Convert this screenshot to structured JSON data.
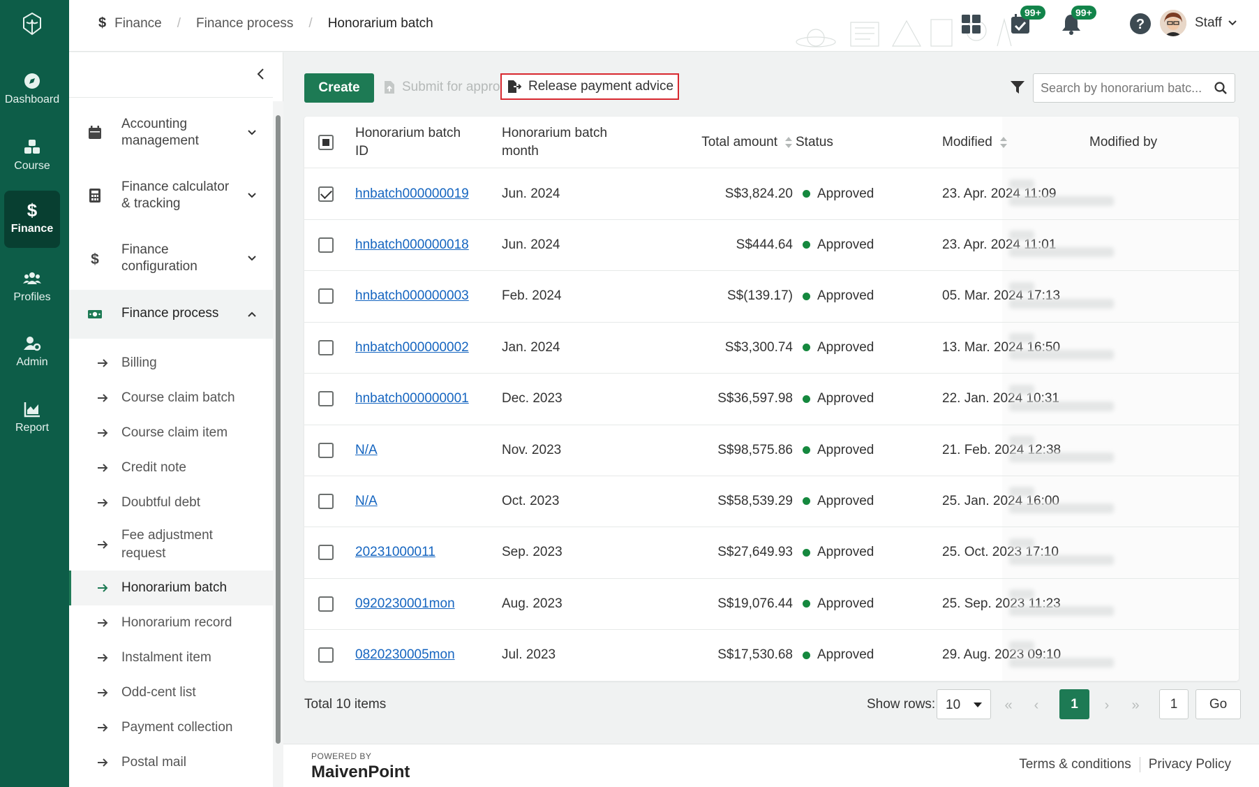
{
  "nav_rail": {
    "items": [
      {
        "label": "Dashboard"
      },
      {
        "label": "Course"
      },
      {
        "label": "Finance"
      },
      {
        "label": "Profiles"
      },
      {
        "label": "Admin"
      },
      {
        "label": "Report"
      }
    ]
  },
  "header": {
    "breadcrumb": [
      "Finance",
      "Finance process",
      "Honorarium batch"
    ],
    "tasks_badge": "99+",
    "notifications_badge": "99+",
    "user_name": "Staff"
  },
  "sidebar": {
    "groups": [
      {
        "label": "Accounting management"
      },
      {
        "label": "Finance calculator & tracking"
      },
      {
        "label": "Finance configuration"
      },
      {
        "label": "Finance process"
      }
    ],
    "subitems": [
      {
        "label": "Billing"
      },
      {
        "label": "Course claim batch"
      },
      {
        "label": "Course claim item"
      },
      {
        "label": "Credit note"
      },
      {
        "label": "Doubtful debt"
      },
      {
        "label": "Fee adjustment request"
      },
      {
        "label": "Honorarium batch"
      },
      {
        "label": "Honorarium record"
      },
      {
        "label": "Instalment item"
      },
      {
        "label": "Odd-cent list"
      },
      {
        "label": "Payment collection"
      },
      {
        "label": "Postal mail"
      }
    ]
  },
  "toolbar": {
    "create_label": "Create",
    "submit_label": "Submit for approval",
    "release_label": "Release payment advice",
    "search_placeholder": "Search by honorarium batc..."
  },
  "table": {
    "columns": {
      "id": "Honorarium batch ID",
      "month": "Honorarium batch month",
      "total": "Total amount",
      "status": "Status",
      "modified": "Modified",
      "modified_by": "Modified by"
    },
    "rows": [
      {
        "checked": true,
        "id": "hnbatch000000019",
        "month": "Jun. 2024",
        "total": "S$3,824.20",
        "status": "Approved",
        "modified": "23. Apr. 2024 11:09"
      },
      {
        "checked": false,
        "id": "hnbatch000000018",
        "month": "Jun. 2024",
        "total": "S$444.64",
        "status": "Approved",
        "modified": "23. Apr. 2024 11:01"
      },
      {
        "checked": false,
        "id": "hnbatch000000003",
        "month": "Feb. 2024",
        "total": "S$(139.17)",
        "status": "Approved",
        "modified": "05. Mar. 2024 17:13"
      },
      {
        "checked": false,
        "id": "hnbatch000000002",
        "month": "Jan. 2024",
        "total": "S$3,300.74",
        "status": "Approved",
        "modified": "13. Mar. 2024 16:50"
      },
      {
        "checked": false,
        "id": "hnbatch000000001",
        "month": "Dec. 2023",
        "total": "S$36,597.98",
        "status": "Approved",
        "modified": "22. Jan. 2024 10:31"
      },
      {
        "checked": false,
        "id": "N/A",
        "month": "Nov. 2023",
        "total": "S$98,575.86",
        "status": "Approved",
        "modified": "21. Feb. 2024 12:38"
      },
      {
        "checked": false,
        "id": "N/A",
        "month": "Oct. 2023",
        "total": "S$58,539.29",
        "status": "Approved",
        "modified": "25. Jan. 2024 16:00"
      },
      {
        "checked": false,
        "id": "20231000011",
        "month": "Sep. 2023",
        "total": "S$27,649.93",
        "status": "Approved",
        "modified": "25. Oct. 2023 17:10"
      },
      {
        "checked": false,
        "id": "0920230001mon",
        "month": "Aug. 2023",
        "total": "S$19,076.44",
        "status": "Approved",
        "modified": "25. Sep. 2023 11:23"
      },
      {
        "checked": false,
        "id": "0820230005mon",
        "month": "Jul. 2023",
        "total": "S$17,530.68",
        "status": "Approved",
        "modified": "29. Aug. 2023 09:10"
      }
    ]
  },
  "pagination": {
    "total_label": "Total 10 items",
    "show_rows_label": "Show rows:",
    "rows_value": "10",
    "current_page": "1",
    "page_input": "1",
    "go_label": "Go"
  },
  "footer": {
    "powered_by": "POWERED BY",
    "brand": "MaivenPoint",
    "terms": "Terms & conditions",
    "privacy": "Privacy Policy"
  },
  "colors": {
    "rail": "#0d5d48",
    "primary": "#1d7a54",
    "link": "#1565c0",
    "approved": "#15883e",
    "highlight": "#d8282f"
  }
}
